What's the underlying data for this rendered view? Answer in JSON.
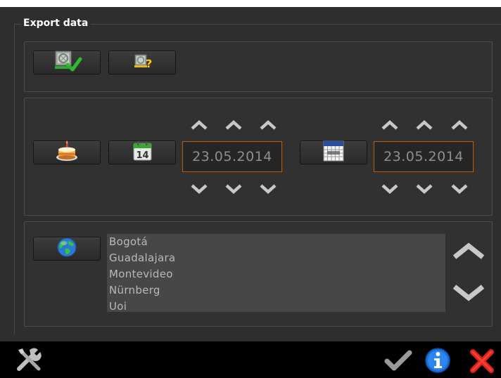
{
  "group": {
    "title": "Export data"
  },
  "dates": {
    "from": "23.05.2014",
    "to": "23.05.2014"
  },
  "calendar_icon": {
    "day": "14"
  },
  "cities": [
    "Bogotá",
    "Guadalajara",
    "Montevideo",
    "Nürnberg",
    "Uoi"
  ],
  "icons": {
    "export_confirm": "export-confirm-icon",
    "export_help": "export-help-icon",
    "birthday": "birthday-cake-icon",
    "today": "calendar-today-icon",
    "calendar": "calendar-month-icon",
    "globe": "globe-icon",
    "tools": "tools-icon",
    "ok": "checkmark-icon",
    "info": "info-icon",
    "close": "close-icon"
  },
  "colors": {
    "accent": "#c05a10",
    "background": "#2e2e2e",
    "list_bg": "#474747",
    "info_blue": "#1a6ed8",
    "close_red": "#e0201a",
    "ok_gray": "#9a9a9a"
  }
}
